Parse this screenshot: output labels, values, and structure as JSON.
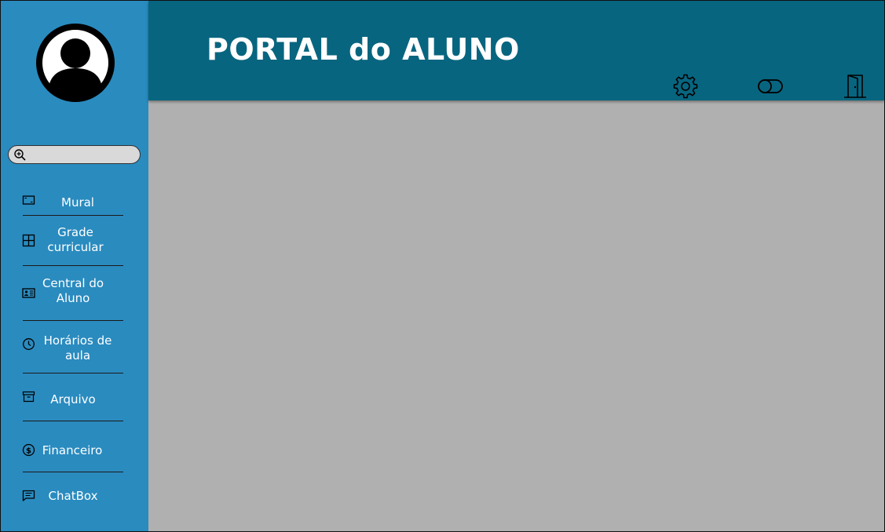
{
  "header": {
    "title": "PORTAL do ALUNO",
    "icons": [
      "gear-icon",
      "toggle-icon",
      "door-exit-icon"
    ]
  },
  "sidebar": {
    "avatar_icon": "user-avatar-icon",
    "search": {
      "icon": "zoom-in-icon",
      "placeholder": "",
      "value": ""
    },
    "items": [
      {
        "label": "Mural",
        "icon": "mural-icon"
      },
      {
        "label": "Grade curricular",
        "icon": "grid-icon"
      },
      {
        "label": "Central do Aluno",
        "icon": "id-card-icon"
      },
      {
        "label": "Horários de aula",
        "icon": "clock-icon"
      },
      {
        "label": "Arquivo",
        "icon": "archive-icon"
      },
      {
        "label": "Financeiro",
        "icon": "dollar-coin-icon"
      },
      {
        "label": "ChatBox",
        "icon": "chat-icon"
      }
    ]
  },
  "colors": {
    "sidebar": "#2a8bbf",
    "header": "#08657f",
    "content": "#b0b0b0"
  }
}
